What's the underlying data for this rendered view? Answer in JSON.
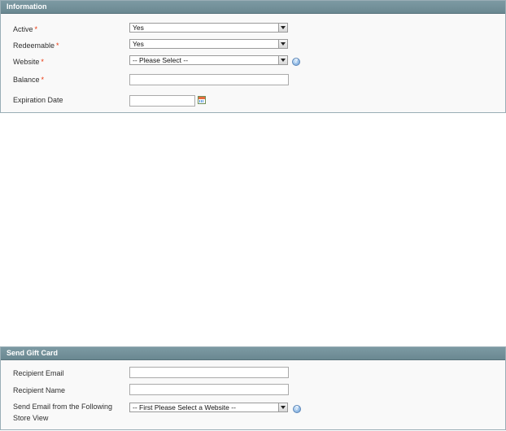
{
  "information": {
    "title": "Information",
    "fields": {
      "active": {
        "label": "Active",
        "required": "*",
        "value": "Yes"
      },
      "redeemable": {
        "label": "Redeemable",
        "required": "*",
        "value": "Yes"
      },
      "website": {
        "label": "Website",
        "required": "*",
        "value": "-- Please Select --"
      },
      "balance": {
        "label": "Balance",
        "required": "*",
        "value": ""
      },
      "expiration": {
        "label": "Expiration Date",
        "value": ""
      }
    }
  },
  "send_gift_card": {
    "title": "Send Gift Card",
    "fields": {
      "recipient_email": {
        "label": "Recipient Email",
        "value": ""
      },
      "recipient_name": {
        "label": "Recipient Name",
        "value": ""
      },
      "store_view": {
        "label_line1": "Send Email from the Following",
        "label_line2": "Store View",
        "value": "-- First Please Select a Website --"
      }
    }
  },
  "icons": {
    "help": "help-icon",
    "calendar": "calendar-icon"
  }
}
